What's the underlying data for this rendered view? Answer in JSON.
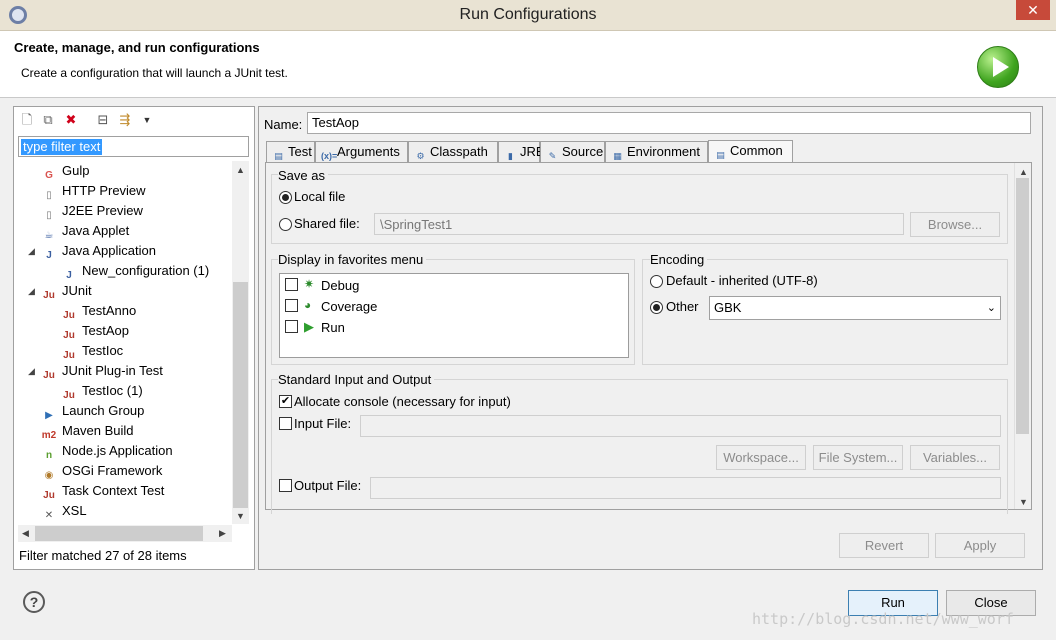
{
  "window": {
    "title": "Run Configurations",
    "close_glyph": "✕"
  },
  "header": {
    "title": "Create, manage, and run configurations",
    "subtitle": "Create a configuration that will launch a JUnit test."
  },
  "left": {
    "filter_placeholder": "type filter text",
    "tree": [
      {
        "label": "Gulp",
        "icon": "gulp-icon",
        "glyph": "G",
        "color": "#d9534f",
        "expander": ""
      },
      {
        "label": "HTTP Preview",
        "icon": "http-preview-icon",
        "glyph": "▯",
        "color": "#777777",
        "expander": ""
      },
      {
        "label": "J2EE Preview",
        "icon": "j2ee-preview-icon",
        "glyph": "▯",
        "color": "#777777",
        "expander": ""
      },
      {
        "label": "Java Applet",
        "icon": "java-applet-icon",
        "glyph": "☕",
        "color": "#3b5fa0",
        "expander": ""
      },
      {
        "label": "Java Application",
        "icon": "java-application-icon",
        "glyph": "J",
        "color": "#3b5fa0",
        "expander": "◢"
      },
      {
        "label": "New_configuration (1)",
        "icon": "java-config-icon",
        "glyph": "J",
        "color": "#3b5fa0",
        "expander": ""
      },
      {
        "label": "JUnit",
        "icon": "junit-icon",
        "glyph": "Ju",
        "color": "#b03a2e",
        "expander": "◢"
      },
      {
        "label": "TestAnno",
        "icon": "junit-config-icon",
        "glyph": "Ju",
        "color": "#b03a2e",
        "expander": ""
      },
      {
        "label": "TestAop",
        "icon": "junit-config-icon",
        "glyph": "Ju",
        "color": "#b03a2e",
        "expander": ""
      },
      {
        "label": "TestIoc",
        "icon": "junit-config-icon",
        "glyph": "Ju",
        "color": "#b03a2e",
        "expander": ""
      },
      {
        "label": "JUnit Plug-in Test",
        "icon": "junit-plugin-icon",
        "glyph": "Ju",
        "color": "#b03a2e",
        "expander": "◢"
      },
      {
        "label": "TestIoc (1)",
        "icon": "junit-plugin-config-icon",
        "glyph": "Ju",
        "color": "#b03a2e",
        "expander": ""
      },
      {
        "label": "Launch Group",
        "icon": "launch-group-icon",
        "glyph": "▶",
        "color": "#2f6fb5",
        "expander": ""
      },
      {
        "label": "Maven Build",
        "icon": "maven-icon",
        "glyph": "m2",
        "color": "#c0392b",
        "expander": ""
      },
      {
        "label": "Node.js Application",
        "icon": "nodejs-icon",
        "glyph": "n",
        "color": "#5a9e2f",
        "expander": ""
      },
      {
        "label": "OSGi Framework",
        "icon": "osgi-icon",
        "glyph": "◉",
        "color": "#b07a2a",
        "expander": ""
      },
      {
        "label": "Task Context Test",
        "icon": "task-context-icon",
        "glyph": "Ju",
        "color": "#b03a2e",
        "expander": ""
      },
      {
        "label": "XSL",
        "icon": "xsl-icon",
        "glyph": "✕",
        "color": "#555555",
        "expander": ""
      }
    ],
    "status": "Filter matched 27 of 28 items"
  },
  "config": {
    "name_label": "Name:",
    "name_value": "TestAop",
    "tabs": [
      {
        "label": "Test",
        "icon": "test-tab-icon",
        "glyph": "▤"
      },
      {
        "label": "Arguments",
        "icon": "arguments-tab-icon",
        "glyph": "(x)="
      },
      {
        "label": "Classpath",
        "icon": "classpath-tab-icon",
        "glyph": "⚙"
      },
      {
        "label": "JRE",
        "icon": "jre-tab-icon",
        "glyph": "▮"
      },
      {
        "label": "Source",
        "icon": "source-tab-icon",
        "glyph": "✎"
      },
      {
        "label": "Environment",
        "icon": "environment-tab-icon",
        "glyph": "▦"
      },
      {
        "label": "Common",
        "icon": "common-tab-icon",
        "glyph": "▤"
      }
    ],
    "save_as": {
      "title": "Save as",
      "local": "Local file",
      "shared": "Shared file:",
      "shared_value": "\\SpringTest1",
      "browse": "Browse..."
    },
    "favorites": {
      "title": "Display in favorites menu",
      "items": [
        {
          "label": "Debug",
          "icon": "debug-icon"
        },
        {
          "label": "Coverage",
          "icon": "coverage-icon"
        },
        {
          "label": "Run",
          "icon": "run-icon"
        }
      ]
    },
    "encoding": {
      "title": "Encoding",
      "default": "Default - inherited (UTF-8)",
      "other": "Other",
      "value": "GBK"
    },
    "stdio": {
      "title": "Standard Input and Output",
      "allocate": "Allocate console (necessary for input)",
      "input": "Input File:",
      "output": "Output File:",
      "workspace": "Workspace...",
      "filesystem": "File System...",
      "variables": "Variables..."
    },
    "revert": "Revert",
    "apply": "Apply"
  },
  "footer": {
    "run": "Run",
    "close": "Close",
    "help": "?"
  },
  "watermark": "http://blog.csdn.net/www_worf"
}
